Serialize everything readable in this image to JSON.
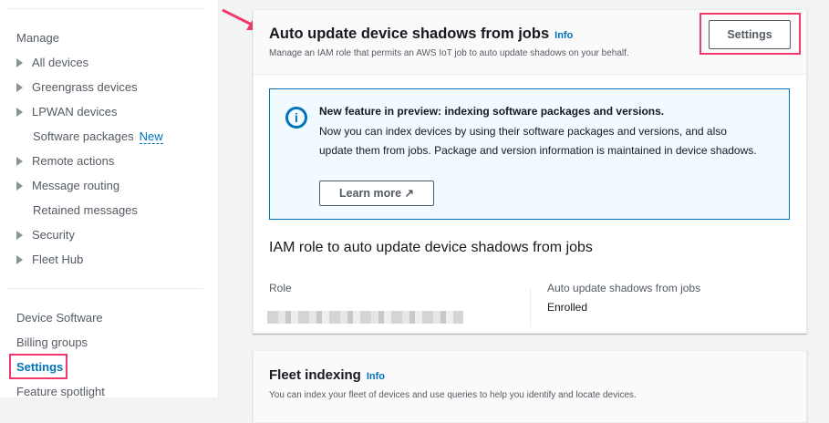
{
  "sidebar": {
    "section": "Manage",
    "items": [
      {
        "label": "All devices",
        "expandable": true
      },
      {
        "label": "Greengrass devices",
        "expandable": true
      },
      {
        "label": "LPWAN devices",
        "expandable": true
      },
      {
        "label": "Software packages",
        "badge": "New"
      },
      {
        "label": "Remote actions",
        "expandable": true
      },
      {
        "label": "Message routing",
        "expandable": true
      },
      {
        "label": "Retained messages"
      },
      {
        "label": "Security",
        "expandable": true
      },
      {
        "label": "Fleet Hub",
        "expandable": true
      }
    ],
    "bottom": [
      "Device Software",
      "Billing groups",
      "Settings",
      "Feature spotlight"
    ]
  },
  "shadows": {
    "title": "Auto update device shadows from jobs",
    "info": "Info",
    "subtitle": "Manage an IAM role that permits an AWS IoT job to auto update shadows on your behalf.",
    "settings_button": "Settings",
    "alert": {
      "title": "New feature in preview: indexing software packages and versions.",
      "body": "Now you can index devices by using their software packages and versions, and also update them from jobs. Package and version information is maintained in device shadows.",
      "learn_more": "Learn more"
    },
    "section_title": "IAM role to auto update device shadows from jobs",
    "role_label": "Role",
    "status_label": "Auto update shadows from jobs",
    "status_value": "Enrolled"
  },
  "fleet": {
    "title": "Fleet indexing",
    "info": "Info",
    "subtitle": "You can index your fleet of devices and use queries to help you identify and locate devices."
  }
}
